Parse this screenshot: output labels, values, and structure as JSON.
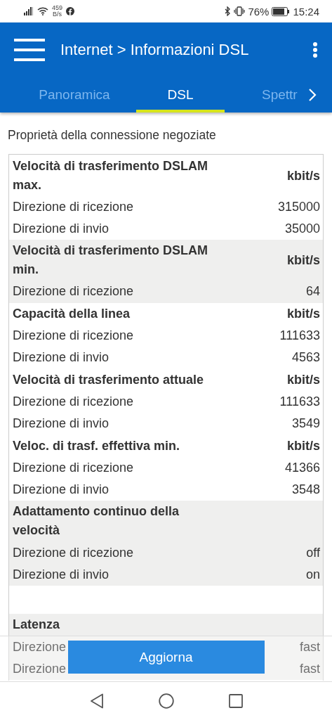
{
  "status_bar": {
    "net_speed": "459",
    "net_unit": "B/s",
    "battery": "76%",
    "time": "15:24"
  },
  "app_bar": {
    "title": "Internet > Informazioni DSL"
  },
  "tabs": [
    {
      "label": "Panoramica",
      "selected": false
    },
    {
      "label": "DSL",
      "selected": true
    },
    {
      "label": "Spettr",
      "selected": false
    }
  ],
  "section_title": "Proprietà della connessione negoziate",
  "groups": [
    {
      "title": "Velocità di trasferimento DSLAM max.",
      "unit": "kbit/s",
      "shaded": false,
      "rows": [
        {
          "label": "Direzione di ricezione",
          "value": "315000"
        },
        {
          "label": "Direzione di invio",
          "value": "35000"
        }
      ]
    },
    {
      "title": "Velocità di trasferimento DSLAM min.",
      "unit": "kbit/s",
      "shaded": true,
      "rows": [
        {
          "label": "Direzione di ricezione",
          "value": "64"
        }
      ]
    },
    {
      "title": "Capacità della linea",
      "unit": "kbit/s",
      "shaded": false,
      "rows": [
        {
          "label": "Direzione di ricezione",
          "value": "111633"
        },
        {
          "label": "Direzione di invio",
          "value": "4563"
        }
      ]
    },
    {
      "title": "Velocità di trasferimento attuale",
      "unit": "kbit/s",
      "shaded": false,
      "rows": [
        {
          "label": "Direzione di ricezione",
          "value": "111633"
        },
        {
          "label": "Direzione di invio",
          "value": "3549"
        }
      ]
    },
    {
      "title": "Veloc. di trasf. effettiva min.",
      "unit": "kbit/s",
      "shaded": false,
      "rows": [
        {
          "label": "Direzione di ricezione",
          "value": "41366"
        },
        {
          "label": "Direzione di invio",
          "value": "3548"
        }
      ]
    },
    {
      "title": "Adattamento continuo della velocità",
      "shaded": true,
      "rows": [
        {
          "label": "Direzione di ricezione",
          "value": "off"
        },
        {
          "label": "Direzione di invio",
          "value": "on"
        },
        {
          "kind": "blank"
        }
      ]
    },
    {
      "title": "Latenza",
      "shaded": true,
      "rows": [
        {
          "label": "Direzione",
          "value": "fast"
        },
        {
          "label": "Direzione",
          "value": "fast"
        }
      ]
    }
  ],
  "button": "Aggiorna"
}
